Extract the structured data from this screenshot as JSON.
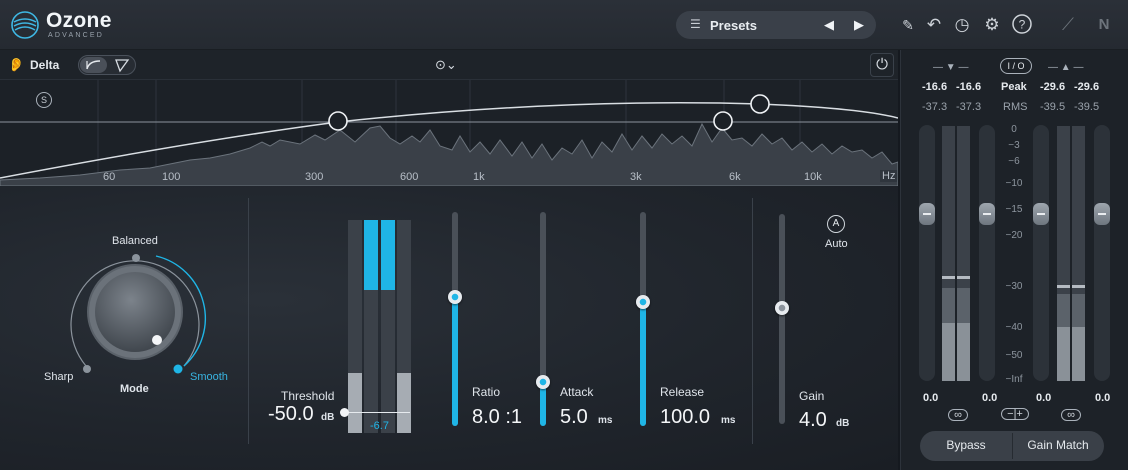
{
  "app": {
    "name": "Ozone",
    "edition": "ADVANCED"
  },
  "header": {
    "presets_label": "Presets",
    "icons": [
      "list-icon",
      "prev-arrow-icon",
      "next-arrow-icon",
      "pen-icon",
      "undo-icon",
      "history-icon",
      "gear-icon",
      "help-icon",
      "fader-icon",
      "ni-logo-icon"
    ]
  },
  "toolbar": {
    "delta_label": "Delta"
  },
  "spectrum": {
    "badge": "S",
    "freq_labels": [
      "60",
      "100",
      "300",
      "600",
      "1k",
      "3k",
      "6k",
      "10k",
      "Hz"
    ]
  },
  "mode": {
    "balanced_label": "Balanced",
    "sharp_label": "Sharp",
    "smooth_label": "Smooth",
    "mode_label": "Mode",
    "selected": "Smooth"
  },
  "threshold": {
    "label": "Threshold",
    "value": "-50.0",
    "unit": "dB",
    "gr_readout": "-6.7"
  },
  "ratio": {
    "label": "Ratio",
    "value": "8.0 :1",
    "level": 0.75
  },
  "attack": {
    "label": "Attack",
    "value": "5.0",
    "unit": "ms",
    "level": 0.2
  },
  "release": {
    "label": "Release",
    "value": "100.0",
    "unit": "ms",
    "level": 0.55
  },
  "gain": {
    "label": "Gain",
    "value": "4.0",
    "unit": "dB",
    "auto_badge": "A",
    "auto_label": "Auto"
  },
  "meters": {
    "io_label": "I / O",
    "peak_label": "Peak",
    "rms_label": "RMS",
    "input_peak": [
      "-16.6",
      "-16.6"
    ],
    "input_rms": [
      "-37.3",
      "-37.3"
    ],
    "output_peak": [
      "-29.6",
      "-29.6"
    ],
    "output_rms": [
      "-39.5",
      "-39.5"
    ],
    "scale": [
      "0",
      "−3",
      "−6",
      "−10",
      "−15",
      "−20",
      "−30",
      "−40",
      "−50",
      "−Inf"
    ],
    "input_gain": "0.0",
    "input_gain_r": "0.0",
    "output_gain": "0.0",
    "output_gain_r": "0.0",
    "bypass_label": "Bypass",
    "gain_match_label": "Gain Match"
  },
  "colors": {
    "accent": "#1fb5e6",
    "background": "#20252c"
  }
}
